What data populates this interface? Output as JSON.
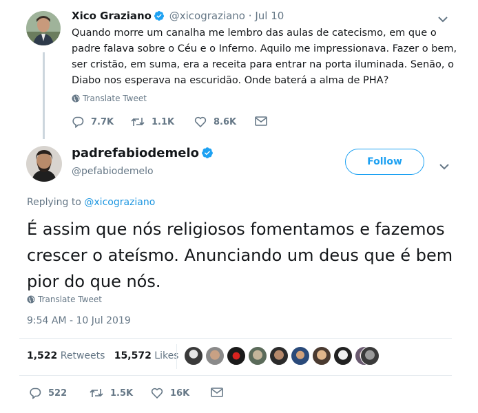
{
  "parent_tweet": {
    "author_name": "Xico Graziano",
    "handle": "@xicograziano",
    "separator": "·",
    "date": "Jul 10",
    "text": "Quando morre um canalha me lembro das aulas de catecismo, em que o padre falava sobre o Céu e o Inferno. Aquilo me impressionava. Fazer o bem, ser cristão, em suma, era a receita para entrar na porta iluminada. Senão, o Diabo nos esperava na escuridão. Onde baterá a alma de PHA?",
    "translate_label": "Translate Tweet",
    "replies": "7.7K",
    "retweets": "1.1K",
    "likes": "8.6K"
  },
  "main_tweet": {
    "author_name": "padrefabiodemelo",
    "handle": "@pefabiodemelo",
    "follow_label": "Follow",
    "replying_prefix": "Replying to",
    "replying_to": "@xicograziano",
    "text": "É assim que nós religiosos fomentamos e fazemos crescer o ateísmo. Anunciando um deus que é bem pior do que nós.",
    "translate_label": "Translate Tweet",
    "timestamp": "9:54 AM - 10 Jul 2019",
    "retweets_count": "1,522",
    "retweets_label": "Retweets",
    "likes_count": "15,572",
    "likes_label": "Likes",
    "replies": "522",
    "retweets": "1.5K",
    "likes": "16K"
  },
  "colors": {
    "accent": "#1da1f2",
    "muted": "#657786",
    "text": "#14171a",
    "divider": "#e6ecf0"
  },
  "icons": [
    "verified-badge-icon",
    "globe-icon",
    "reply-icon",
    "retweet-icon",
    "like-icon",
    "message-icon",
    "chevron-down-icon"
  ]
}
